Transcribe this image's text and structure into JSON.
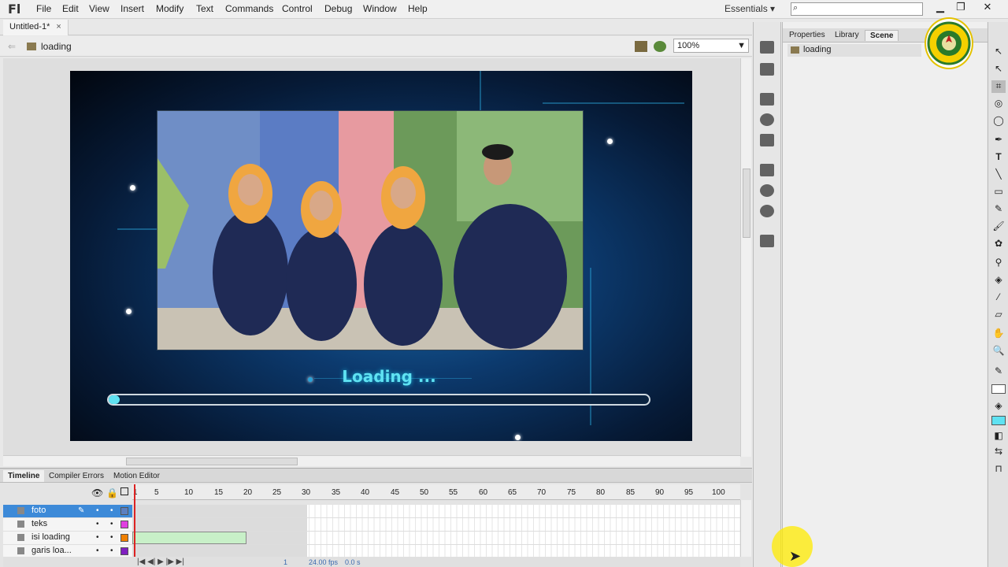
{
  "app": {
    "logo": "Fl",
    "menu": [
      "File",
      "Edit",
      "View",
      "Insert",
      "Modify",
      "Text",
      "Commands",
      "Control",
      "Debug",
      "Window",
      "Help"
    ],
    "workspace": "Essentials ▾",
    "search_placeholder": ""
  },
  "document": {
    "tab": "Untitled-1*",
    "scene": "loading",
    "zoom": "100%"
  },
  "stage": {
    "loading_text": "Loading ...",
    "progress": 0.02,
    "accent": "#5fe2f2"
  },
  "timeline": {
    "tabs": [
      "Timeline",
      "Compiler Errors",
      "Motion Editor"
    ],
    "ruler": [
      "1",
      "5",
      "10",
      "15",
      "20",
      "25",
      "30",
      "35",
      "40",
      "45",
      "50",
      "55",
      "60",
      "65",
      "70",
      "75",
      "80",
      "85",
      "90",
      "95",
      "100"
    ],
    "layers": [
      {
        "name": "foto",
        "color": "#5b7fc0",
        "selected": true
      },
      {
        "name": "teks",
        "color": "#e040e0",
        "selected": false
      },
      {
        "name": "isi loading",
        "color": "#f08000",
        "selected": false
      },
      {
        "name": "garis loa...",
        "color": "#8020c0",
        "selected": false
      }
    ],
    "footer": {
      "frame": "1",
      "fps": "24.00 fps",
      "time": "0.0 s"
    }
  },
  "panel": {
    "tabs": [
      "Properties",
      "Library",
      "Scene"
    ],
    "active_tab": "Scene",
    "scene_item": "loading"
  }
}
